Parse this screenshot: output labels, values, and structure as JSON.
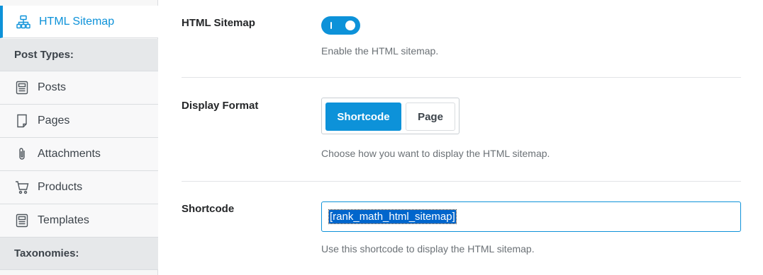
{
  "sidebar": {
    "active_item": "HTML Sitemap",
    "post_types_heading": "Post Types:",
    "items": [
      {
        "label": "Posts",
        "icon": "document-icon"
      },
      {
        "label": "Pages",
        "icon": "page-icon"
      },
      {
        "label": "Attachments",
        "icon": "paperclip-icon"
      },
      {
        "label": "Products",
        "icon": "cart-icon"
      },
      {
        "label": "Templates",
        "icon": "template-icon"
      }
    ],
    "taxonomies_heading": "Taxonomies:"
  },
  "settings": {
    "html_sitemap": {
      "label": "HTML Sitemap",
      "enabled": true,
      "description": "Enable the HTML sitemap."
    },
    "display_format": {
      "label": "Display Format",
      "options": [
        "Shortcode",
        "Page"
      ],
      "selected": "Shortcode",
      "description": "Choose how you want to display the HTML sitemap."
    },
    "shortcode": {
      "label": "Shortcode",
      "value": "[rank_math_html_sitemap]",
      "description": "Use this shortcode to display the HTML sitemap."
    }
  },
  "colors": {
    "accent": "#0d92d9",
    "selection": "#0066cc"
  }
}
